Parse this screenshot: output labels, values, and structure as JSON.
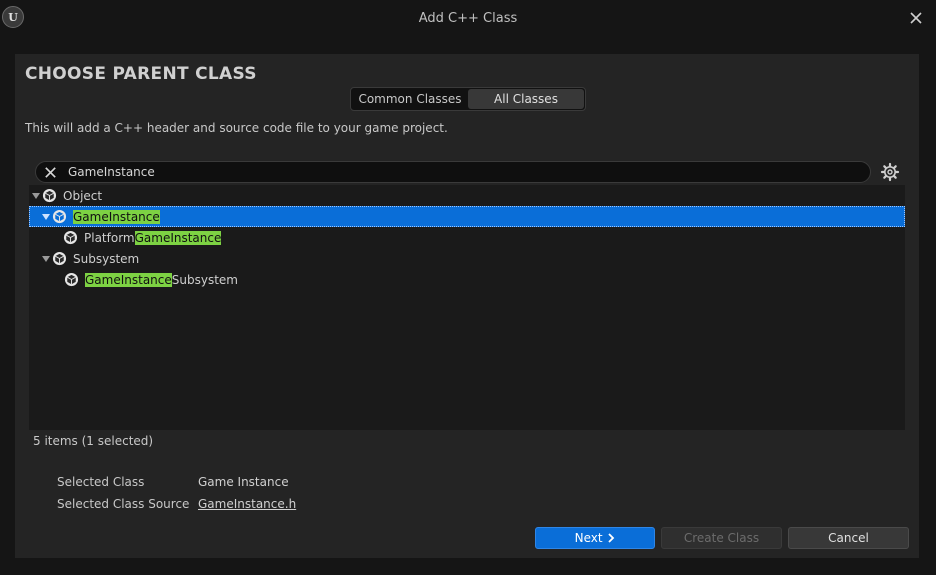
{
  "window": {
    "title": "Add C++ Class",
    "logo_text": "U"
  },
  "heading": "CHOOSE PARENT CLASS",
  "tabs": [
    {
      "label": "Common Classes",
      "active": false
    },
    {
      "label": "All Classes",
      "active": true
    }
  ],
  "subtitle": "This will add a C++ header and source code file to your game project.",
  "search": {
    "value": "GameInstance",
    "placeholder": ""
  },
  "tree": [
    {
      "name": "Object",
      "pre": "",
      "match": "",
      "post": "Object",
      "depth": 0,
      "expanded": true,
      "selected": false
    },
    {
      "name": "GameInstance",
      "pre": "",
      "match": "GameInstance",
      "post": "",
      "depth": 1,
      "expanded": true,
      "selected": true
    },
    {
      "name": "PlatformGameInstance",
      "pre": "Platform",
      "match": "GameInstance",
      "post": "",
      "depth": 2,
      "expanded": false,
      "selected": false
    },
    {
      "name": "Subsystem",
      "pre": "",
      "match": "",
      "post": "Subsystem",
      "depth": 1,
      "expanded": true,
      "selected": false
    },
    {
      "name": "GameInstanceSubsystem",
      "pre": "",
      "match": "GameInstance",
      "post": "Subsystem",
      "depth": 2,
      "expanded": false,
      "selected": false
    }
  ],
  "status": {
    "count_text": "5 items (1 selected)"
  },
  "info": {
    "selected_class_label": "Selected Class",
    "selected_class_value": "Game Instance",
    "selected_source_label": "Selected Class Source",
    "selected_source_value": "GameInstance.h"
  },
  "buttons": {
    "next": "Next",
    "create": "Create Class",
    "cancel": "Cancel"
  },
  "colors": {
    "accent": "#0a6ed8",
    "highlight": "#7dd243",
    "panel": "#242424",
    "background": "#151515"
  },
  "icons": {
    "logo": "unreal-logo-icon",
    "close": "close-icon",
    "clear": "clear-search-icon",
    "settings": "gear-icon",
    "class": "class-cube-icon",
    "expand": "expand-arrow-icon",
    "next": "chevron-right-icon"
  }
}
